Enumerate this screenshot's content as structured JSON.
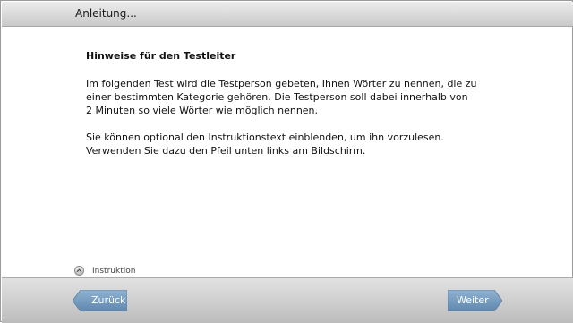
{
  "window": {
    "title": "Anleitung..."
  },
  "content": {
    "heading": "Hinweise für den Testleiter",
    "paragraph1": [
      "Im folgenden Test wird die Testperson gebeten, Ihnen Wörter zu nennen, die zu",
      "einer bestimmten Kategorie gehören. Die Testperson soll dabei innerhalb von",
      "2 Minuten so viele Wörter wie möglich nennen."
    ],
    "paragraph2": [
      "Sie können optional den Instruktionstext einblenden, um ihn vorzulesen.",
      "Verwenden Sie dazu den Pfeil unten links am Bildschirm."
    ]
  },
  "instruction_toggle": {
    "label": "Instruktion",
    "icon": "chevron-up-icon"
  },
  "navigation": {
    "back_label": "Zurück",
    "next_label": "Weiter",
    "button_color": "#6f98bd"
  }
}
